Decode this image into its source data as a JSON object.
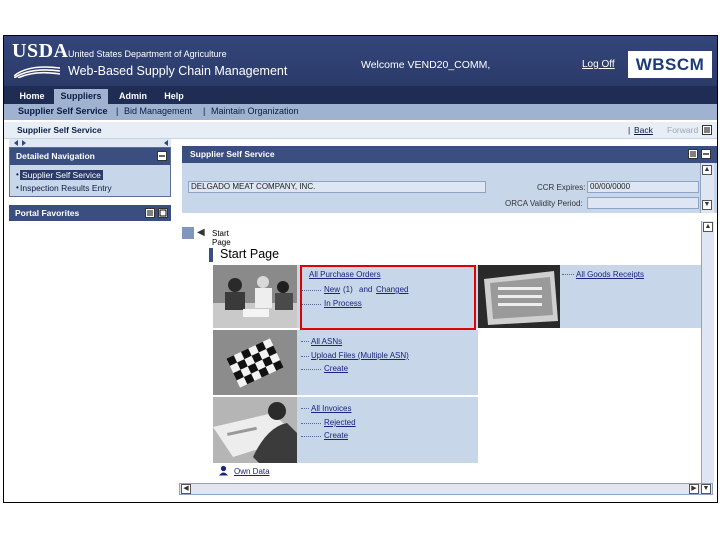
{
  "header": {
    "logo": "USDA",
    "org": "United States Department of Agriculture",
    "app_title": "Web-Based Supply Chain Management",
    "welcome": "Welcome VEND20_COMM,",
    "logoff": "Log Off",
    "brand": "WBSCM",
    "colors": {
      "banner": "#2f3f6e",
      "accent": "#9fb3d1",
      "highlight_box": "#e00000"
    }
  },
  "top_tabs": [
    "Home",
    "Suppliers",
    "Admin",
    "Help"
  ],
  "active_tab": "Suppliers",
  "sub_nav": [
    "Supplier Self Service",
    "Bid Management",
    "Maintain Organization"
  ],
  "page_bar": {
    "title": "Supplier Self Service",
    "back": "Back",
    "forward": "Forward",
    "separator": "|"
  },
  "left_nav": {
    "header": "Detailed Navigation",
    "items": [
      "Supplier Self Service",
      "Inspection Results Entry"
    ],
    "selected": "Supplier Self Service",
    "favorites": "Portal Favorites"
  },
  "content": {
    "header": "Supplier Self Service",
    "company": "DELGADO MEAT COMPANY, INC.",
    "ccr_label": "CCR Expires:",
    "ccr_value": "00/00/0000",
    "orca_label": "ORCA Validity Period:",
    "orca_value": "",
    "breadcrumb": "Start Page",
    "title": "Start Page"
  },
  "sections": {
    "purchase_orders": {
      "main": "All Purchase Orders",
      "new": "New",
      "count": "(1)",
      "and": "and",
      "changed": "Changed",
      "in_process": "In Process"
    },
    "goods_receipts": {
      "main": "All Goods Receipts"
    },
    "asns": {
      "main": "All ASNs",
      "upload": "Upload Files (Multiple ASN)",
      "create": "Create"
    },
    "invoices": {
      "main": "All Invoices",
      "rejected": "Rejected",
      "create": "Create"
    },
    "own_data": "Own Data"
  }
}
